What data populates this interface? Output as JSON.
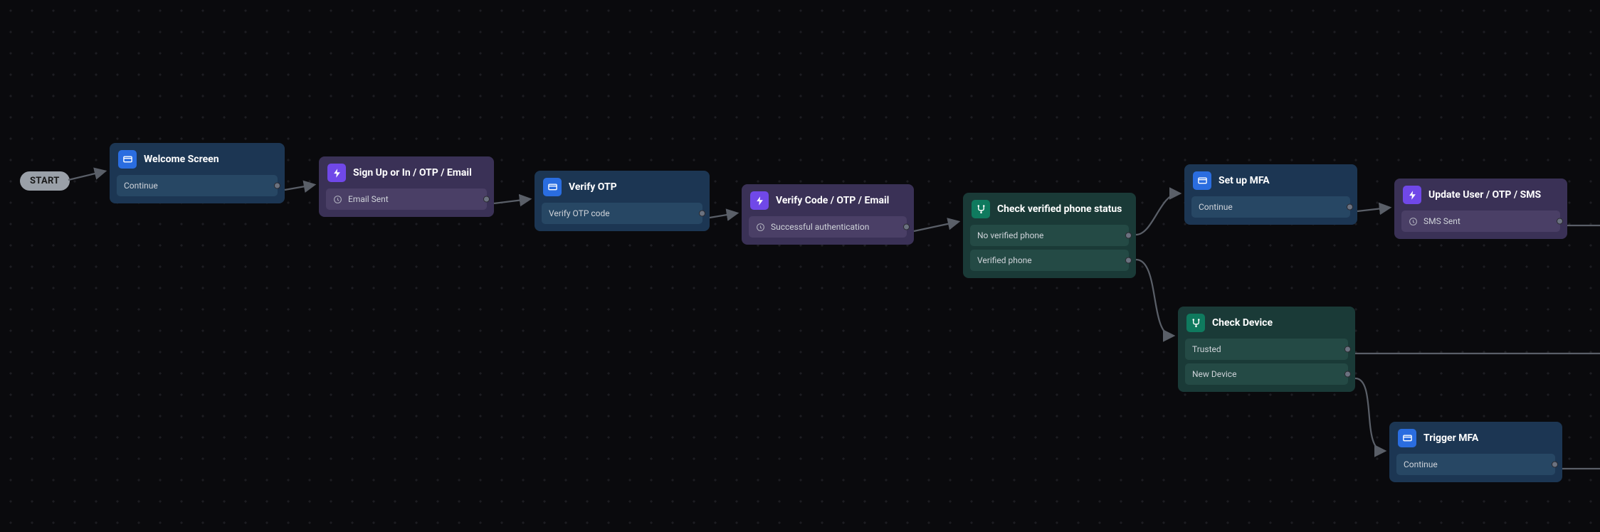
{
  "start_label": "START",
  "nodes": {
    "welcome": {
      "title": "Welcome Screen",
      "type": "screen",
      "outputs": [
        "Continue"
      ]
    },
    "signup": {
      "title": "Sign Up or In / OTP / Email",
      "type": "action",
      "outputs": [
        "Email Sent"
      ]
    },
    "verify_otp": {
      "title": "Verify OTP",
      "type": "screen",
      "outputs": [
        "Verify OTP code"
      ]
    },
    "verify_code": {
      "title": "Verify Code / OTP / Email",
      "type": "action",
      "outputs": [
        "Successful authentication"
      ]
    },
    "check_phone": {
      "title": "Check verified phone status",
      "type": "condition",
      "outputs": [
        "No verified phone",
        "Verified phone"
      ]
    },
    "setup_mfa": {
      "title": "Set up MFA",
      "type": "screen",
      "outputs": [
        "Continue"
      ]
    },
    "check_device": {
      "title": "Check Device",
      "type": "condition",
      "outputs": [
        "Trusted",
        "New Device"
      ]
    },
    "update_user": {
      "title": "Update User / OTP / SMS",
      "type": "action",
      "outputs": [
        "SMS Sent"
      ]
    },
    "trigger_mfa": {
      "title": "Trigger MFA",
      "type": "screen",
      "outputs": [
        "Continue"
      ]
    }
  },
  "colors": {
    "screen_bg": "#1c3653",
    "action_bg": "#3a3156",
    "condition_bg": "#1a3a37",
    "screen_icon": "#2a6de0",
    "action_icon": "#7048e8",
    "condition_icon": "#0f7a5e",
    "edge": "#5a5f68"
  },
  "edges": [
    [
      "start",
      "welcome"
    ],
    [
      "welcome.Continue",
      "signup"
    ],
    [
      "signup.Email Sent",
      "verify_otp"
    ],
    [
      "verify_otp.Verify OTP code",
      "verify_code"
    ],
    [
      "verify_code.Successful authentication",
      "check_phone"
    ],
    [
      "check_phone.No verified phone",
      "setup_mfa"
    ],
    [
      "check_phone.Verified phone",
      "check_device"
    ],
    [
      "setup_mfa.Continue",
      "update_user"
    ],
    [
      "check_device.Trusted",
      "offscreen"
    ],
    [
      "check_device.New Device",
      "trigger_mfa"
    ],
    [
      "update_user.SMS Sent",
      "offscreen"
    ],
    [
      "trigger_mfa.Continue",
      "offscreen"
    ]
  ]
}
